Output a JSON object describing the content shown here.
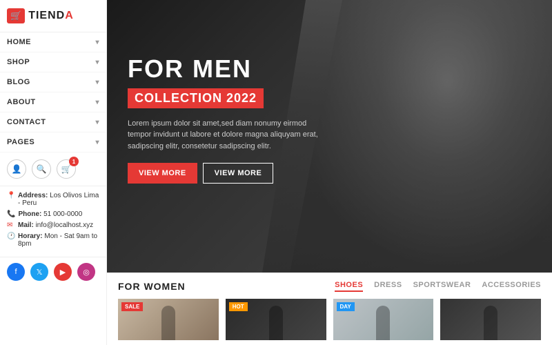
{
  "logo": {
    "icon": "🛒",
    "name": "TIENDA",
    "name_highlight": "A"
  },
  "sidebar": {
    "nav_items": [
      {
        "label": "HOME",
        "has_dropdown": true
      },
      {
        "label": "SHOP",
        "has_dropdown": true
      },
      {
        "label": "BLOG",
        "has_dropdown": true
      },
      {
        "label": "ABOUT",
        "has_dropdown": true
      },
      {
        "label": "CONTACT",
        "has_dropdown": true
      },
      {
        "label": "PAGES",
        "has_dropdown": true
      }
    ],
    "icons": {
      "user": "👤",
      "search": "🔍",
      "cart": "🛒",
      "cart_count": "1"
    },
    "contact": {
      "address_label": "Address:",
      "address_value": "Los Olivos Lima - Peru",
      "phone_label": "Phone:",
      "phone_value": "51 000-0000",
      "mail_label": "Mail:",
      "mail_value": "info@localhost.xyz",
      "horary_label": "Horary:",
      "horary_value": "Mon - Sat 9am to 8pm"
    },
    "social": [
      {
        "name": "facebook",
        "class": "fb",
        "symbol": "f"
      },
      {
        "name": "twitter",
        "class": "tw",
        "symbol": "t"
      },
      {
        "name": "youtube",
        "class": "yt",
        "symbol": "▶"
      },
      {
        "name": "instagram",
        "class": "ig",
        "symbol": "◎"
      }
    ]
  },
  "hero": {
    "title": "FOR MEN",
    "badge": "COLLECTION 2022",
    "description": "Lorem ipsum dolor sit amet,sed diam nonumy eirmod tempor invidunt ut labore et dolore magna aliquyam erat, sadipscing elitr, consetetur sadipscing elitr.",
    "button1": "VIEW MORE",
    "button2": "VIEW MORE"
  },
  "women_section": {
    "title": "FOR WOMEN",
    "tabs": [
      {
        "label": "SHOES",
        "active": true
      },
      {
        "label": "DRESS",
        "active": false
      },
      {
        "label": "SPORTSWEAR",
        "active": false
      },
      {
        "label": "ACCESSORIES",
        "active": false
      }
    ],
    "products": [
      {
        "badge": "SALE",
        "badge_type": "sale"
      },
      {
        "badge": "HOT",
        "badge_type": "hot"
      },
      {
        "badge": "DAY",
        "badge_type": "day"
      },
      {
        "badge": "",
        "badge_type": "none"
      }
    ]
  }
}
